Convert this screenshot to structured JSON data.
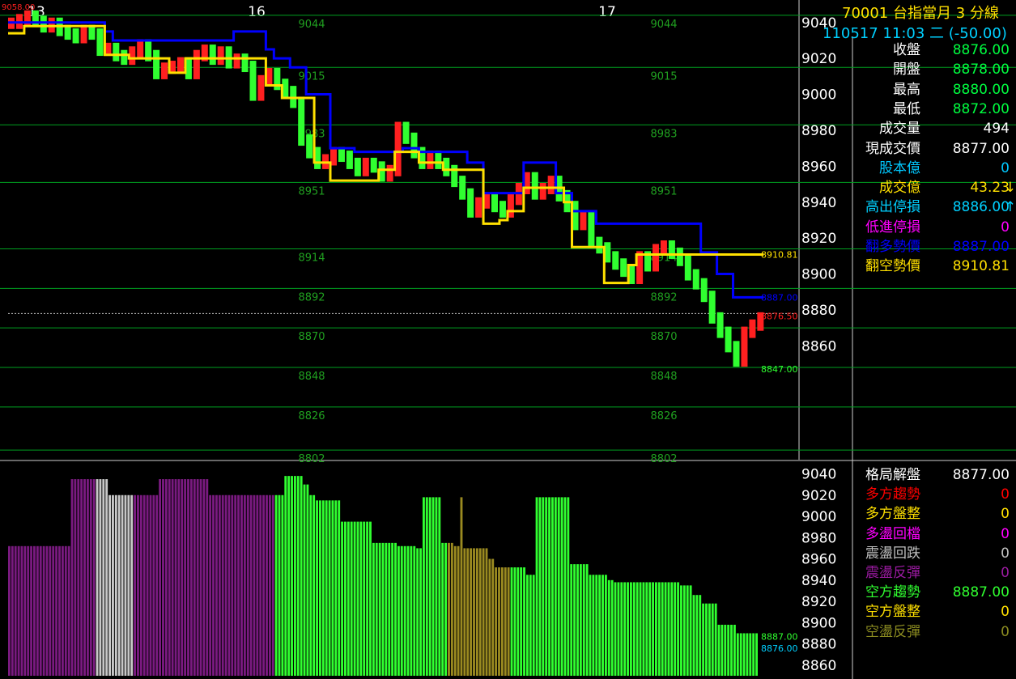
{
  "header": {
    "title": "70001  台指當月 3 分線",
    "datetime": "110517 11:03 二",
    "change": "(-50.00)"
  },
  "date_labels": [
    "13",
    "16",
    "17"
  ],
  "top_left_marker": "9058.00",
  "info_panel": [
    {
      "label": "收盤",
      "value": "8876.00",
      "label_color": "#ffffff",
      "value_color": "#00ff40"
    },
    {
      "label": "開盤",
      "value": "8878.00",
      "label_color": "#ffffff",
      "value_color": "#00ff40"
    },
    {
      "label": "最高",
      "value": "8880.00",
      "label_color": "#ffffff",
      "value_color": "#00ff40"
    },
    {
      "label": "最低",
      "value": "8872.00",
      "label_color": "#ffffff",
      "value_color": "#00ff40"
    },
    {
      "label": "成交量",
      "value": "494",
      "label_color": "#ffffff",
      "value_color": "#ffffff"
    },
    {
      "label": "現成交價",
      "value": "8877.00",
      "label_color": "#ffffff",
      "value_color": "#ffffff"
    },
    {
      "label": "股本億",
      "value": "0",
      "label_color": "#00c8ff",
      "value_color": "#00c8ff"
    },
    {
      "label": "成交億",
      "value": "43.23",
      "label_color": "#ffe000",
      "value_color": "#ffe000",
      "arrow": "↓",
      "arrow_color": "#ffe000"
    },
    {
      "label": "高出停損",
      "value": "8886.00",
      "label_color": "#00d0ff",
      "value_color": "#00d0ff",
      "arrow": "↑",
      "arrow_color": "#00d0ff"
    },
    {
      "label": "低進停損",
      "value": "0",
      "label_color": "#ff00ff",
      "value_color": "#ff00ff"
    },
    {
      "label": "翻多勢價",
      "value": "8887.00",
      "label_color": "#0000ff",
      "value_color": "#0000ff"
    },
    {
      "label": "翻空勢價",
      "value": "8910.81",
      "label_color": "#ffe000",
      "value_color": "#ffe000"
    }
  ],
  "lower_panel": [
    {
      "label": "格局解盤",
      "value": "8877.00",
      "label_color": "#ffffff",
      "value_color": "#ffffff"
    },
    {
      "label": "多方趨勢",
      "value": "0",
      "label_color": "#ff0000",
      "value_color": "#ff0000"
    },
    {
      "label": "多方盤整",
      "value": "0",
      "label_color": "#ffe000",
      "value_color": "#ffe000"
    },
    {
      "label": "多盪回檔",
      "value": "0",
      "label_color": "#ff00ff",
      "value_color": "#ff00ff"
    },
    {
      "label": "震盪回跌",
      "value": "0",
      "label_color": "#c0c0c0",
      "value_color": "#c0c0c0"
    },
    {
      "label": "震盪反彈",
      "value": "0",
      "label_color": "#9a1aa0",
      "value_color": "#9a1aa0"
    },
    {
      "label": "空方趨勢",
      "value": "8887.00",
      "label_color": "#30ff30",
      "value_color": "#30ff30"
    },
    {
      "label": "空方盤整",
      "value": "0",
      "label_color": "#ffe000",
      "value_color": "#ffe000"
    },
    {
      "label": "空盪反彈",
      "value": "0",
      "label_color": "#8a8a20",
      "value_color": "#8a8a20"
    }
  ],
  "chart_data": [
    {
      "type": "line",
      "y_ticks": [
        9040,
        9020,
        9000,
        8980,
        8960,
        8940,
        8920,
        8900,
        8880,
        8860
      ],
      "ylim": [
        8798,
        9048
      ],
      "levels": [
        9044,
        9015,
        8983,
        8951,
        8914,
        8892,
        8870,
        8848,
        8826,
        8802
      ],
      "x": [
        0,
        10,
        20,
        30,
        40,
        50,
        60,
        70,
        80,
        90,
        100,
        110,
        120,
        130,
        140,
        150,
        160,
        170,
        180,
        190,
        200,
        210,
        220,
        230,
        240,
        250,
        260,
        270,
        280,
        290,
        300,
        310,
        320,
        330,
        340,
        350,
        360,
        370,
        380,
        390,
        400,
        410,
        420,
        430,
        440,
        450,
        460,
        470,
        480,
        490,
        500,
        510,
        520,
        530,
        540,
        550,
        560,
        570,
        580,
        590,
        600,
        610,
        620,
        630,
        640,
        650,
        660,
        670,
        680,
        690,
        700,
        710,
        720,
        730,
        740,
        750,
        760,
        770,
        780,
        790,
        800,
        810,
        820,
        830,
        840,
        850,
        860,
        870,
        880,
        890,
        900,
        910,
        920,
        930
      ],
      "series": [
        {
          "color": "#00ff40",
          "values": [
            9040,
            9042,
            9044,
            9041,
            9038,
            9040,
            9036,
            9034,
            9032,
            9036,
            9034,
            9025,
            9026,
            9022,
            9020,
            9024,
            9028,
            9022,
            9012,
            9015,
            9016,
            9018,
            9012,
            9022,
            9025,
            9020,
            9024,
            9018,
            9020,
            9016,
            9000,
            9008,
            9012,
            9006,
            9002,
            8996,
            8975,
            8968,
            8962,
            8964,
            8968,
            8966,
            8962,
            8958,
            8962,
            8960,
            8955,
            8958,
            8982,
            8976,
            8968,
            8962,
            8966,
            8962,
            8958,
            8952,
            8945,
            8935,
            8940,
            8942,
            8938,
            8935,
            8942,
            8948,
            8954,
            8945,
            8948,
            8952,
            8944,
            8938,
            8928,
            8932,
            8918,
            8915,
            8910,
            8906,
            8902,
            8898,
            8910,
            8905,
            8914,
            8916,
            8912,
            8908,
            8900,
            8895,
            8888,
            8876,
            8868,
            8860,
            8852,
            8868,
            8872,
            8876
          ]
        },
        {
          "color": "#0000ff",
          "values": [
            9040,
            9040,
            9040,
            9040,
            9040,
            9040,
            9040,
            9040,
            9040,
            9040,
            9040,
            9040,
            9035,
            9030,
            9030,
            9030,
            9030,
            9030,
            9030,
            9030,
            9030,
            9030,
            9030,
            9030,
            9030,
            9030,
            9030,
            9030,
            9035,
            9035,
            9035,
            9035,
            9025,
            9020,
            9020,
            9015,
            9015,
            9000,
            9000,
            9000,
            8970,
            8970,
            8970,
            8968,
            8968,
            8968,
            8968,
            8968,
            8968,
            8970,
            8970,
            8968,
            8968,
            8968,
            8968,
            8968,
            8968,
            8962,
            8962,
            8945,
            8945,
            8945,
            8945,
            8945,
            8962,
            8962,
            8962,
            8962,
            8945,
            8945,
            8935,
            8935,
            8935,
            8928,
            8928,
            8928,
            8928,
            8928,
            8928,
            8928,
            8928,
            8928,
            8928,
            8928,
            8928,
            8928,
            8912,
            8912,
            8900,
            8900,
            8887,
            8887,
            8887,
            8887
          ]
        },
        {
          "color": "#ffe000",
          "values": [
            9034,
            9034,
            9038,
            9038,
            9038,
            9038,
            9038,
            9038,
            9038,
            9038,
            9038,
            9038,
            9022,
            9022,
            9022,
            9020,
            9020,
            9020,
            9020,
            9020,
            9012,
            9012,
            9020,
            9020,
            9020,
            9020,
            9020,
            9020,
            9020,
            9020,
            9020,
            9020,
            9005,
            9005,
            8998,
            8998,
            8998,
            8998,
            8962,
            8962,
            8952,
            8952,
            8952,
            8952,
            8952,
            8952,
            8958,
            8958,
            8968,
            8968,
            8968,
            8962,
            8962,
            8962,
            8958,
            8958,
            8958,
            8958,
            8958,
            8928,
            8928,
            8930,
            8935,
            8935,
            8948,
            8948,
            8948,
            8948,
            8948,
            8940,
            8915,
            8915,
            8915,
            8915,
            8895,
            8895,
            8895,
            8905,
            8910.81,
            8910.81,
            8910.81,
            8910.81,
            8910.81,
            8910.81,
            8910.81,
            8910.81,
            8910.81,
            8910.81,
            8910.81,
            8910.81,
            8910.81,
            8910.81,
            8910.81,
            8910.81
          ]
        }
      ],
      "annotations": [
        {
          "label": "8910.81",
          "value": 8910.81,
          "color": "#ffe000"
        },
        {
          "label": "8887.00",
          "value": 8887,
          "color": "#0000ff"
        },
        {
          "label": "8876.50",
          "value": 8876.5,
          "color": "#ff2020"
        },
        {
          "label": "8847.00",
          "value": 8847,
          "color": "#30ff30"
        }
      ]
    },
    {
      "type": "bar",
      "y_ticks": [
        9040,
        9020,
        9000,
        8980,
        8960,
        8940,
        8920,
        8900,
        8880,
        8860
      ],
      "ylim": [
        8850,
        9048
      ],
      "values": [
        8972,
        8972,
        8972,
        8972,
        8972,
        8972,
        8972,
        8972,
        8972,
        8972,
        8972,
        8972,
        8972,
        8972,
        8972,
        8972,
        8972,
        8972,
        8972,
        8972,
        9035,
        9035,
        9035,
        9035,
        9035,
        9035,
        9035,
        9035,
        9035,
        9035,
        9035,
        9035,
        9020,
        9020,
        9020,
        9020,
        9020,
        9020,
        9020,
        9020,
        9020,
        9020,
        9020,
        9020,
        9020,
        9020,
        9020,
        9020,
        9035,
        9035,
        9035,
        9035,
        9035,
        9035,
        9035,
        9035,
        9035,
        9035,
        9035,
        9035,
        9035,
        9035,
        9035,
        9035,
        9020,
        9020,
        9020,
        9020,
        9020,
        9020,
        9020,
        9020,
        9020,
        9020,
        9020,
        9020,
        9020,
        9020,
        9020,
        9020,
        9020,
        9020,
        9020,
        9020,
        9020,
        9020,
        9020,
        9020,
        9038,
        9038,
        9038,
        9038,
        9038,
        9038,
        9030,
        9030,
        9020,
        9020,
        9015,
        9015,
        9015,
        9015,
        9015,
        9015,
        9015,
        9015,
        8995,
        8995,
        8995,
        8995,
        8995,
        8995,
        8995,
        8995,
        8995,
        8995,
        8975,
        8975,
        8975,
        8975,
        8975,
        8975,
        8975,
        8975,
        8972,
        8972,
        8972,
        8972,
        8972,
        8972,
        8970,
        8970,
        9018,
        9018,
        9018,
        9018,
        9018,
        9018,
        8975,
        8975,
        8975,
        8975,
        8972,
        8972,
        9018,
        8970,
        8970,
        8970,
        8970,
        8970,
        8970,
        8970,
        8970,
        8960,
        8960,
        8952,
        8952,
        8952,
        8952,
        8952,
        8952,
        8952,
        8952,
        8952,
        8952,
        8945,
        8945,
        8945,
        9018,
        9018,
        9018,
        9018,
        9018,
        9018,
        9018,
        9018,
        9018,
        9018,
        9018,
        8955,
        8955,
        8955,
        8955,
        8955,
        8955,
        8945,
        8945,
        8945,
        8945,
        8945,
        8945,
        8940,
        8940,
        8938,
        8938,
        8938,
        8938,
        8938,
        8938,
        8938,
        8938,
        8938,
        8938,
        8938,
        8938,
        8938,
        8938,
        8938,
        8938,
        8938,
        8938,
        8938,
        8938,
        8938,
        8935,
        8935,
        8935,
        8935,
        8926,
        8926,
        8926,
        8918,
        8918,
        8918,
        8918,
        8918,
        8898,
        8898,
        8898,
        8898,
        8898,
        8898,
        8890,
        8890,
        8890,
        8890,
        8890,
        8890,
        8890
      ]
    }
  ]
}
